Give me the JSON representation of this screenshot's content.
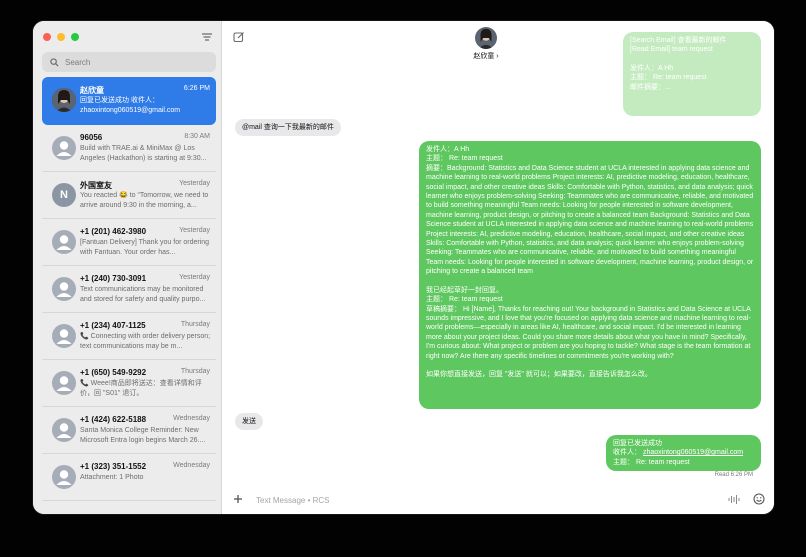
{
  "colors": {
    "sidebar_bg": "#ececec",
    "selected_blue": "#2f7be8",
    "bubble_green": "#5fc75f",
    "bubble_gray": "#e8e8ea",
    "traffic_red": "#fe5f57",
    "traffic_yellow": "#febc2e",
    "traffic_green": "#28c840"
  },
  "search": {
    "placeholder": "Search"
  },
  "conversations": [
    {
      "name": "赵欣童",
      "time": "6:26 PM",
      "preview": "回复已发送成功 收件人： zhaoxintong060519@gmail.com",
      "avatar": "photo"
    },
    {
      "name": "96056",
      "time": "8:30 AM",
      "preview": "Build with TRAE.ai & MiniMax @ Los Angeles (Hackathon) is starting at 9:30...",
      "avatar": "person-icon"
    },
    {
      "name": "外国室友",
      "time": "Yesterday",
      "preview": "You reacted 😂 to “Tomorrow, we need to arrive around 9:30 in the morning, a...",
      "avatar": "N"
    },
    {
      "name": "+1 (201) 462-3980",
      "time": "Yesterday",
      "preview": "[Fantuan Delivery] Thank you for ordering with Fantuan. Your order has...",
      "avatar": "person-icon"
    },
    {
      "name": "+1 (240) 730-3091",
      "time": "Yesterday",
      "preview": "Text communications may be monitored and stored for safety and quality purpo...",
      "avatar": "person-icon"
    },
    {
      "name": "+1 (234) 407-1125",
      "time": "Thursday",
      "preview": "📞 Connecting with order delivery person; text communications may be m...",
      "avatar": "person-icon"
    },
    {
      "name": "+1 (650) 549-9292",
      "time": "Thursday",
      "preview": "📞 Weee!商品即将送达：查看详情和评价，回 \"S01\" 退订。",
      "avatar": "person-icon"
    },
    {
      "name": "+1 (424) 622-5188",
      "time": "Wednesday",
      "preview": "Santa Monica College Reminder: New Microsoft Entra login begins March 26....",
      "avatar": "person-icon"
    },
    {
      "name": "+1 (323) 351-1552",
      "time": "Wednesday",
      "preview": "Attachment: 1 Photo",
      "avatar": "person-icon"
    }
  ],
  "header": {
    "contact_name": "赵欣童 ›"
  },
  "messages": {
    "top_faded": {
      "line1": "[Search Email] 查看最新的邮件",
      "line2": "[Read Email] team request",
      "line3": "发件人：A Hh",
      "line4": "主题： Re: team request",
      "line5": "邮件摘要：..."
    },
    "incoming_1": "@mail 查询一下我最新的邮件",
    "big": {
      "from": "发件人：A Hh",
      "subject": "主题： Re: team request",
      "summary": "摘要：Background: Statistics and Data Science student at UCLA interested in applying data science and machine learning to real-world problems Project interests: AI, predictive modeling, education, healthcare, social impact, and other creative ideas Skills: Comfortable with Python, statistics, and data analysis; quick learner who enjoys problem-solving Seeking: Teammates who are communicative, reliable, and motivated to build something meaningful Team needs: Looking for people interested in software development, machine learning, product design, or pitching to create a balanced team Background: Statistics and Data Science student at UCLA interested in applying data science and machine learning to real-world problems Project interests: AI, predictive modeling, education, healthcare, social impact, and other creative ideas Skills: Comfortable with Python, statistics, and data analysis; quick learner who enjoys problem-solving Seeking: Teammates who are communicative, reliable, and motivated to build something meaningful Team needs: Looking for people interested in software development, machine learning, product design, or pitching to create a balanced team",
      "drafted": "我已经起草好一封回复。",
      "subject2": "主题： Re: team request",
      "draft": "草稿摘要： Hi [Name], Thanks for reaching out! Your background in Statistics and Data Science at UCLA sounds impressive, and I love that you're focused on applying data science and machine learning to real-world problems—especially in areas like AI, healthcare, and social impact. I'd be interested in learning more about your project ideas. Could you share more details about what you have in mind? Specifically, I'm curious about: What project or problem are you hoping to tackle? What stage is the team formation at right now? Are there any specific timelines or commitments you're working with?",
      "footer": "如果你想直接发送，回复 \"发送\" 就可以；如果要改，直接告诉我怎么改。"
    },
    "incoming_2": "发送",
    "sent": {
      "line1": "回复已发送成功",
      "line2_label": "收件人：",
      "line2_email": "zhaoxintong060519@gmail.com",
      "line3": "主题： Re: team request"
    },
    "read_receipt": "Read 6:26 PM"
  },
  "composer": {
    "placeholder": "Text Message • RCS"
  }
}
